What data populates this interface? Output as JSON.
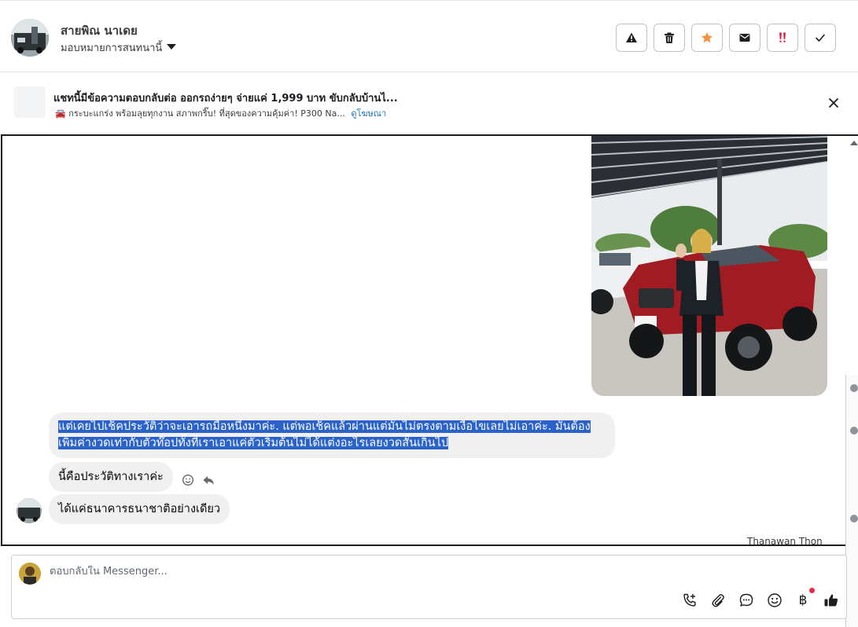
{
  "header": {
    "contact_name": "สายพิณ นาเดย",
    "assign_label": "มอบหมายการสนทนานี้",
    "actions": [
      "warning-icon",
      "trash-icon",
      "star-icon",
      "mail-icon",
      "important-icon",
      "check-icon"
    ],
    "colors": {
      "star": "#f7923b",
      "important": "#e41e3f"
    }
  },
  "ad": {
    "title": "แชทนี้มีข้อความตอบกลับต่อ ออกรถง่ายๆ จ่ายแค่ 1,999 บาท ขับกลับบ้านไ...",
    "subtitle": "🚘 กระบะแกร่ง พร้อมลุยทุกงาน สภาพกริ๊บ! ที่สุดของความคุ้มค่า! P300 Na...",
    "link_label": "ดูโฆษณา"
  },
  "messages": [
    {
      "text": "แต่เคยไปเช็คประวัติว่าจะเอารถมือหนึ่งมาค่ะ. แต่พอเช็คแล้วผ่านแต่มันไม่ตรงตามเงื่อไขเลยไม่เอาค่ะ. มันต้องเพิ่มค่างวดเท่ากับตัวท๊อปทั้งที่เราเอาแค่ตัวเริ่มต้นไม่ได้แต่งอะไรเลยงวดสั้นเกินไป"
    },
    {
      "text": "นี้คือประวัติทางเราค่ะ"
    },
    {
      "text": "ได้แค่ธนาคารธนาชาติอย่างเดียว"
    }
  ],
  "sender_label": "Thanawan Thon",
  "composer": {
    "placeholder": "ตอบกลับใน Messenger...",
    "tools": [
      "phone-plus-icon",
      "attachment-icon",
      "saved-reply-icon",
      "emoji-icon",
      "baht-icon",
      "like-icon"
    ],
    "baht_symbol": "฿"
  }
}
